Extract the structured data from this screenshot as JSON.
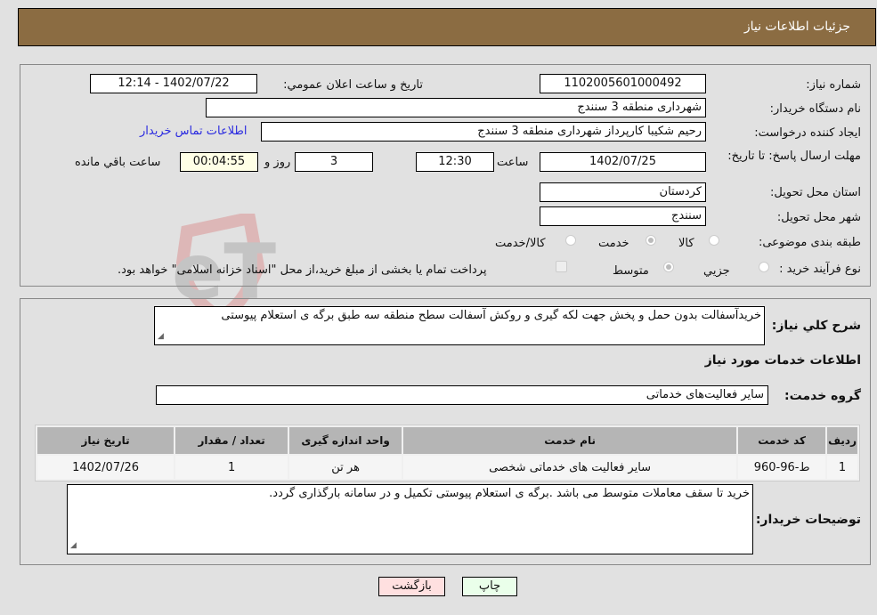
{
  "header": {
    "title": "جزئیات اطلاعات نیاز"
  },
  "fields": {
    "need_number": {
      "label": "شماره نیاز:",
      "value": "1102005601000492"
    },
    "announce_datetime": {
      "label": "تاریخ و ساعت اعلان عمومي:",
      "value": "1402/07/22 - 12:14"
    },
    "buyer_org": {
      "label": "نام دستگاه خریدار:",
      "value": "شهرداری منطقه 3 سنندج"
    },
    "requester": {
      "label": "ایجاد کننده درخواست:",
      "value": "رحیم شکیبا کارپرداز شهرداری منطقه 3 سنندج"
    },
    "buyer_contact_link": "اطلاعات تماس خریدار",
    "deadline": {
      "label": "مهلت ارسال پاسخ: تا تاریخ:",
      "date": "1402/07/25",
      "time_label": "ساعت",
      "time": "12:30",
      "days": "3",
      "days_label": "روز و",
      "remaining": "00:04:55",
      "remaining_label": "ساعت باقي مانده"
    },
    "province": {
      "label": "استان محل تحویل:",
      "value": "کردستان"
    },
    "city": {
      "label": "شهر محل تحویل:",
      "value": "سنندج"
    },
    "category": {
      "label": "طبقه بندی موضوعی:",
      "options": [
        "کالا",
        "خدمت",
        "کالا/خدمت"
      ],
      "selected": "خدمت"
    },
    "purchase_process": {
      "label": "نوع فرآیند خرید :",
      "options": [
        "جزيي",
        "متوسط"
      ],
      "selected": "متوسط",
      "treasury_note": "پرداخت تمام یا بخشی از مبلغ خرید،از محل \"اسناد خزانه اسلامی\" خواهد بود."
    }
  },
  "description": {
    "label": "شرح کلي نیاز:",
    "value": "خریدآسفالت بدون حمل و پخش  جهت لکه گیری و روکش آسفالت سطح منطقه سه طبق برگه ی استعلام پیوستی"
  },
  "services_section": {
    "title": "اطلاعات خدمات مورد نیاز",
    "group_label": "گروه خدمت:",
    "group_value": "سایر فعالیت‌های خدماتی"
  },
  "table": {
    "headers": [
      "ردیف",
      "کد خدمت",
      "نام خدمت",
      "واحد اندازه گیری",
      "تعداد / مقدار",
      "تاریخ نیاز"
    ],
    "rows": [
      [
        "1",
        "ط-96-960",
        "سایر فعالیت های خدماتی شخصی",
        "هر تن",
        "1",
        "1402/07/26"
      ]
    ]
  },
  "buyer_notes": {
    "label": "توضیحات خریدار:",
    "value": "خرید تا سقف معاملات متوسط می باشد .برگه ی استعلام پیوستی تکمیل و در سامانه بارگذاری گردد."
  },
  "buttons": {
    "print": "چاپ",
    "back": "بازگشت"
  },
  "colors": {
    "header_bg": "#8b6c42",
    "print_bg": "#eaffea",
    "back_bg": "#ffe0e0",
    "link": "#2a2ae0"
  },
  "watermark": "AriaTender.neT"
}
